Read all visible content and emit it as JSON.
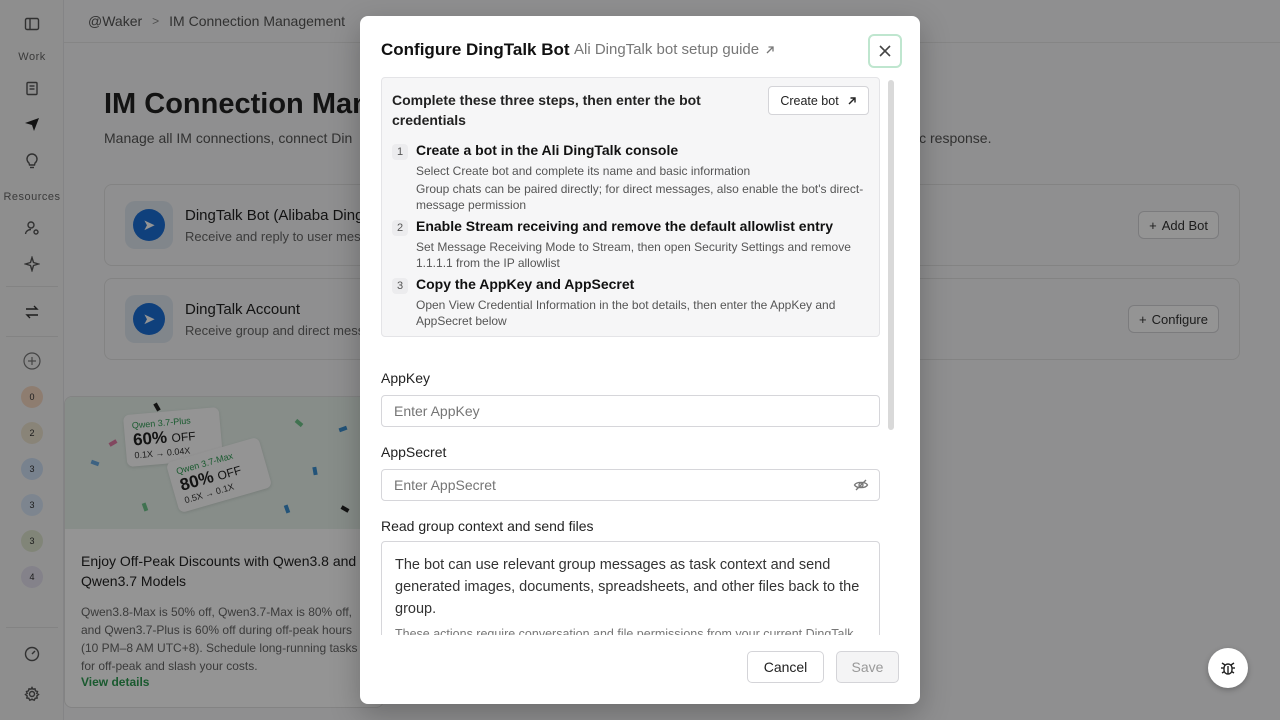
{
  "breadcrumb": {
    "workspace": "@Waker",
    "separator": ">",
    "page": "IM Connection Management"
  },
  "sidebar": {
    "section_work": "Work",
    "section_resources": "Resources",
    "avatars": [
      "0",
      "2",
      "3",
      "3",
      "3",
      "4"
    ]
  },
  "page": {
    "title": "IM Connection Mana",
    "subtitle_left": "Manage all IM connections, connect Din",
    "subtitle_right": "ic response."
  },
  "cards": [
    {
      "title": "DingTalk Bot (Alibaba DingT",
      "desc": "Receive and reply to user messa",
      "button": "Add Bot"
    },
    {
      "title": "DingTalk Account",
      "desc": "Receive group and direct messa",
      "button": "Configure"
    }
  ],
  "promo": {
    "tag1_small": "Qwen 3.7-Plus",
    "tag1_big": "60%",
    "tag1_off": "OFF",
    "tag1_price": "0.1X → 0.04X",
    "tag2_small": "Qwen 3.7-Max",
    "tag2_big": "80%",
    "tag2_off": "OFF",
    "tag2_price": "0.5X → 0.1X",
    "title": "Enjoy Off-Peak Discounts with Qwen3.8 and Qwen3.7 Models",
    "desc": "Qwen3.8-Max is 50% off, Qwen3.7-Max is 80% off, and Qwen3.7-Plus is 60% off during off-peak hours (10 PM–8 AM UTC+8). Schedule long-running tasks for off-peak and slash your costs.",
    "link": "View details"
  },
  "modal": {
    "title": "Configure DingTalk Bot",
    "guide_link": "Ali DingTalk bot setup guide",
    "steps_heading": "Complete these three steps, then enter the bot credentials",
    "create_bot_label": "Create bot",
    "steps": [
      {
        "num": "1",
        "title": "Create a bot in the Ali DingTalk console",
        "desc1": "Select Create bot and complete its name and basic information",
        "desc2": "Group chats can be paired directly; for direct messages, also enable the bot's direct-message permission"
      },
      {
        "num": "2",
        "title": "Enable Stream receiving and remove the default allowlist entry",
        "desc1": "Set Message Receiving Mode to Stream, then open Security Settings and remove 1.1.1.1 from the IP allowlist"
      },
      {
        "num": "3",
        "title": "Copy the AppKey and AppSecret",
        "desc1": "Open View Credential Information in the bot details, then enter the AppKey and AppSecret below"
      }
    ],
    "appkey_label": "AppKey",
    "appkey_placeholder": "Enter AppKey",
    "appsecret_label": "AppSecret",
    "appsecret_placeholder": "Enter AppSecret",
    "context_label": "Read group context and send files",
    "context_main": "The bot can use relevant group messages as task context and send generated images, documents, spreadsheets, and other files back to the group.",
    "context_sub": "These actions require conversation and file permissions from your current DingTalk account, so DWS must be installed locally and authorized through DingTalk sign-in.",
    "cancel_label": "Cancel",
    "save_label": "Save"
  },
  "colors": {
    "accent_green": "#2d9b52",
    "dingtalk_blue": "#1b6fd6",
    "overlay": "#00000069"
  }
}
